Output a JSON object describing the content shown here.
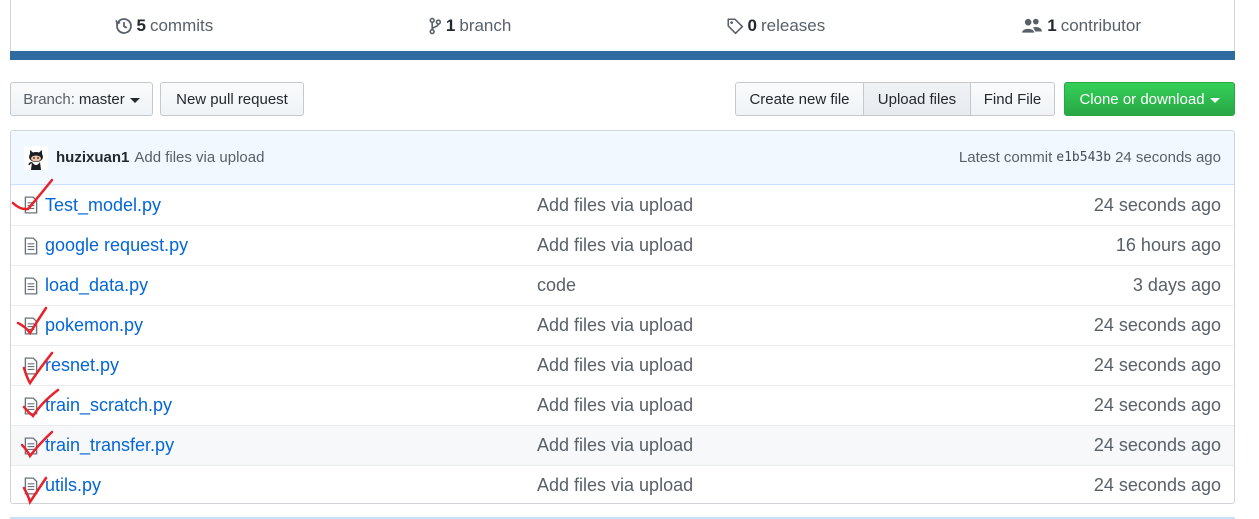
{
  "stats": {
    "commits": {
      "count": "5",
      "label": "commits"
    },
    "branch": {
      "count": "1",
      "label": "branch"
    },
    "releases": {
      "count": "0",
      "label": "releases"
    },
    "contributor": {
      "count": "1",
      "label": "contributor"
    }
  },
  "toolbar": {
    "branch_prefix": "Branch:",
    "branch_value": "master",
    "new_pull_request": "New pull request",
    "create_new_file": "Create new file",
    "upload_files": "Upload files",
    "find_file": "Find File",
    "clone_or_download": "Clone or download"
  },
  "latest_commit": {
    "author": "huzixuan1",
    "message": "Add files via upload",
    "prefix": "Latest commit",
    "sha": "e1b543b",
    "age": "24 seconds ago"
  },
  "files": [
    {
      "name": "Test_model.py",
      "message": "Add files via upload",
      "age": "24 seconds ago"
    },
    {
      "name": "google request.py",
      "message": "Add files via upload",
      "age": "16 hours ago"
    },
    {
      "name": "load_data.py",
      "message": "code",
      "age": "3 days ago"
    },
    {
      "name": "pokemon.py",
      "message": "Add files via upload",
      "age": "24 seconds ago"
    },
    {
      "name": "resnet.py",
      "message": "Add files via upload",
      "age": "24 seconds ago"
    },
    {
      "name": "train_scratch.py",
      "message": "Add files via upload",
      "age": "24 seconds ago"
    },
    {
      "name": "train_transfer.py",
      "message": "Add files via upload",
      "age": "24 seconds ago"
    },
    {
      "name": "utils.py",
      "message": "Add files via upload",
      "age": "24 seconds ago"
    }
  ],
  "colors": {
    "link": "#0366d6",
    "clone_button": "#28a745",
    "stats_bar": "#2f6aa1",
    "annotation_checks": "#e8212b"
  }
}
